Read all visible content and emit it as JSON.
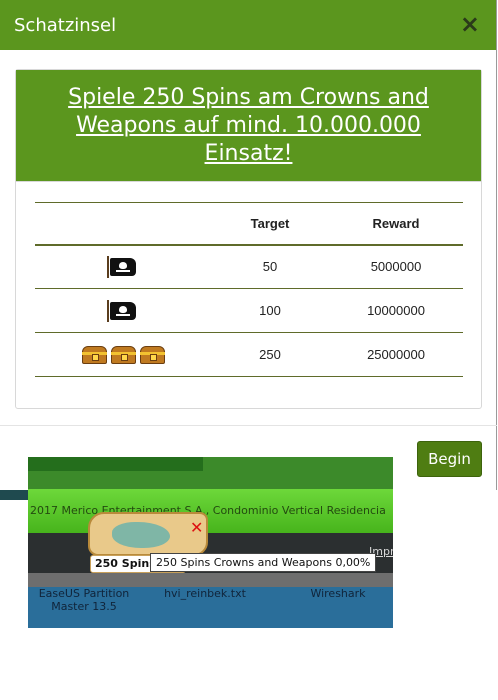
{
  "modal": {
    "title": "Schatzinsel",
    "close_symbol": "×",
    "headline": "Spiele 250 Spins am Crowns and Weapons auf mind. 10.000.000 Einsatz!",
    "table": {
      "headers": [
        "",
        "Target",
        "Reward"
      ],
      "rows": [
        {
          "icon": "pirate-flag-icon",
          "target": "50",
          "reward": "5000000"
        },
        {
          "icon": "pirate-flag-icon",
          "target": "100",
          "reward": "10000000"
        },
        {
          "icon": "treasure-chest-icon",
          "target": "250",
          "reward": "25000000"
        }
      ]
    },
    "begin_label": "Begin"
  },
  "background_fragment": {
    "copyright": "2017 Merico Entertainment S.A., Condominio Vertical Residencia",
    "impr_link": "Impr",
    "mission_label": "250 Spins Crowns and Weapons",
    "tooltip": "250 Spins Crowns and Weapons 0,00%",
    "desktop_icons": [
      {
        "label": "EaseUS Partition Master 13.5"
      },
      {
        "label": "hvi_reinbek.txt"
      },
      {
        "label": "Wireshark"
      }
    ]
  },
  "colors": {
    "header_green": "#5b961e",
    "button_green": "#4f7d12",
    "table_rule": "#5f6b2a"
  }
}
